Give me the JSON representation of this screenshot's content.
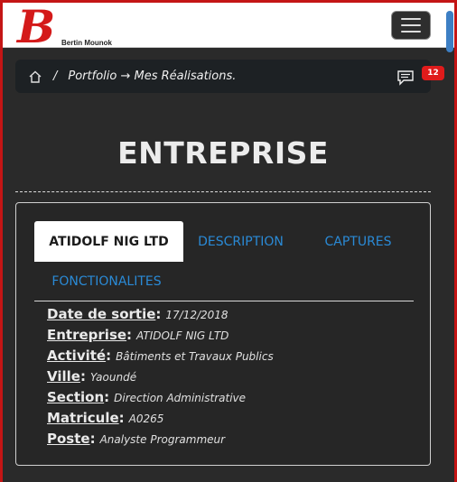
{
  "brand": {
    "logo_letter": "B",
    "name": "Bertin Mounok"
  },
  "breadcrumb": {
    "separator": "/",
    "path": "Portfolio → Mes Réalisations."
  },
  "notifications": {
    "count": "12"
  },
  "page": {
    "title": "ENTREPRISE"
  },
  "tabs": [
    {
      "label": "ATIDOLF NIG LTD",
      "active": true
    },
    {
      "label": "DESCRIPTION",
      "active": false
    },
    {
      "label": "CAPTURES",
      "active": false
    },
    {
      "label": "FONCTIONALITES",
      "active": false
    }
  ],
  "details": [
    {
      "label": "Date de sortie",
      "value": "17/12/2018"
    },
    {
      "label": "Entreprise",
      "value": "ATIDOLF NIG LTD"
    },
    {
      "label": "Activité",
      "value": "Bâtiments et Travaux Publics"
    },
    {
      "label": "Ville",
      "value": "Yaoundé"
    },
    {
      "label": "Section",
      "value": "Direction Administrative"
    },
    {
      "label": "Matricule",
      "value": "A0265"
    },
    {
      "label": "Poste",
      "value": "Analyste Programmeur"
    }
  ],
  "colors": {
    "accent": "#2a8ad6",
    "brand": "#d41a1a",
    "badge": "#e01b1b"
  },
  "icons": [
    "home-icon",
    "message-icon",
    "menu-icon"
  ]
}
